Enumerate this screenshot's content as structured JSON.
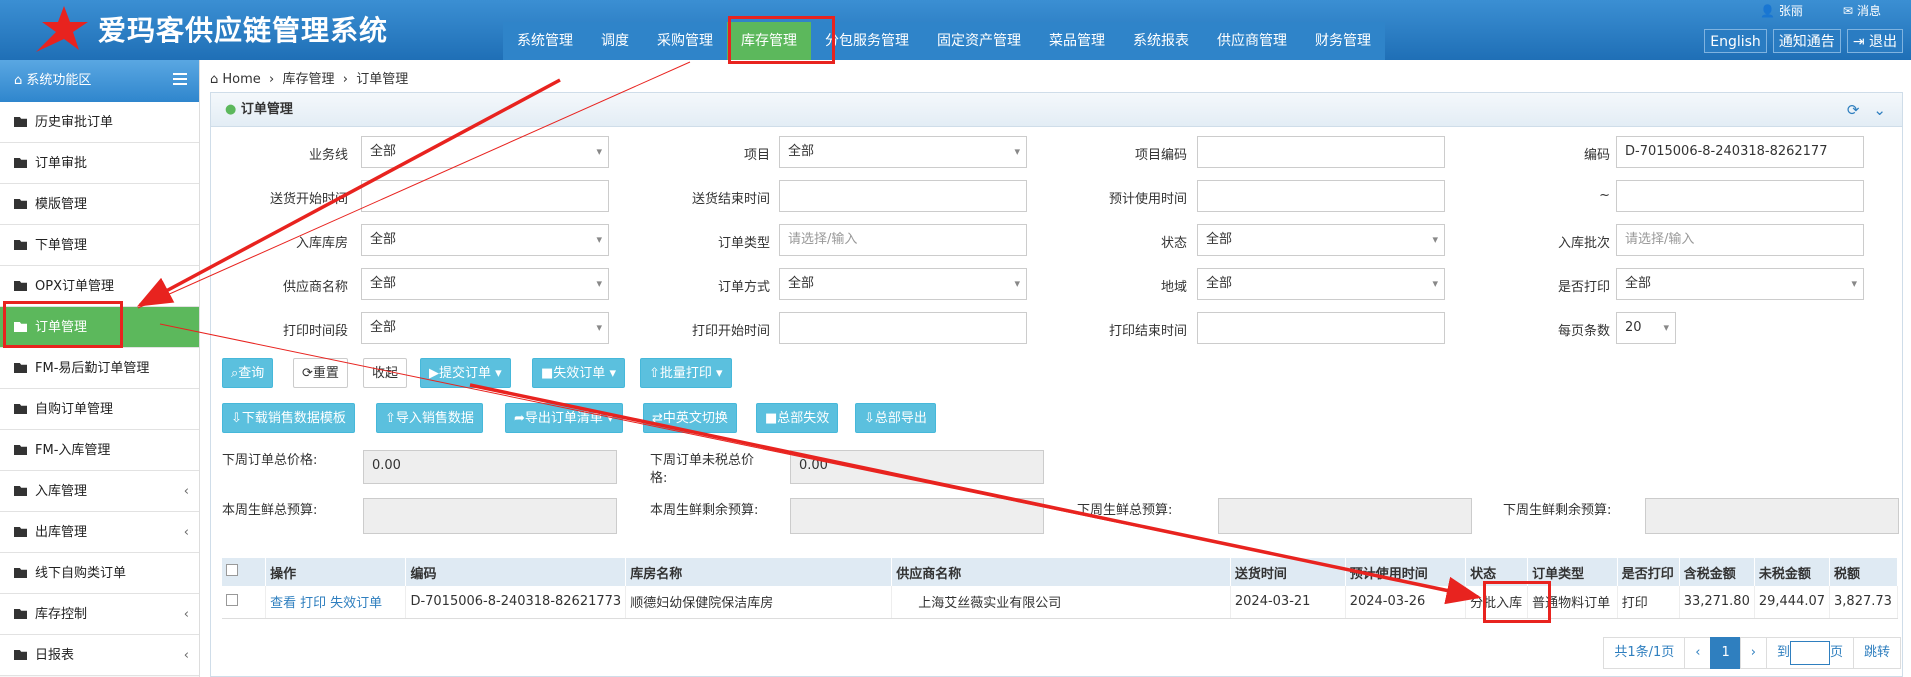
{
  "app": {
    "title": "爱玛客供应链管理系统"
  },
  "topnav": [
    "系统管理",
    "调度",
    "采购管理",
    "库存管理",
    "分包服务管理",
    "固定资产管理",
    "菜品管理",
    "系统报表",
    "供应商管理",
    "财务管理"
  ],
  "user": {
    "name": "张丽",
    "messages": "消息"
  },
  "header_buttons": [
    "English",
    "通知通告",
    "退出"
  ],
  "sidebar": {
    "title": "系统功能区",
    "items": [
      {
        "label": "历史审批订单",
        "chev": ""
      },
      {
        "label": "订单审批",
        "chev": ""
      },
      {
        "label": "模版管理",
        "chev": ""
      },
      {
        "label": "下单管理",
        "chev": ""
      },
      {
        "label": "OPX订单管理",
        "chev": ""
      },
      {
        "label": "订单管理",
        "chev": ""
      },
      {
        "label": "FM-易后勤订单管理",
        "chev": ""
      },
      {
        "label": "自购订单管理",
        "chev": ""
      },
      {
        "label": "FM-入库管理",
        "chev": ""
      },
      {
        "label": "入库管理",
        "chev": "‹"
      },
      {
        "label": "出库管理",
        "chev": "‹"
      },
      {
        "label": "线下自购类订单",
        "chev": ""
      },
      {
        "label": "库存控制",
        "chev": "‹"
      },
      {
        "label": "日报表",
        "chev": "‹"
      }
    ]
  },
  "breadcrumb": {
    "home": "Home",
    "sep": "›",
    "level1": "库存管理",
    "level2": "订单管理"
  },
  "panel": {
    "title": "订单管理"
  },
  "form": {
    "business_line": {
      "label": "业务线",
      "value": "全部"
    },
    "project": {
      "label": "项目",
      "value": "全部"
    },
    "project_code": {
      "label": "项目编码",
      "value": ""
    },
    "code": {
      "label": "编码",
      "value": "D-7015006-8-240318-8262177"
    },
    "delivery_start": {
      "label": "送货开始时间",
      "value": ""
    },
    "delivery_end": {
      "label": "送货结束时间",
      "value": ""
    },
    "expected_use": {
      "label": "预计使用时间",
      "value": ""
    },
    "tilde": {
      "label": "~",
      "value": ""
    },
    "warehouse": {
      "label": "入库库房",
      "value": "全部"
    },
    "order_type": {
      "label": "订单类型",
      "placeholder": "请选择/输入"
    },
    "status": {
      "label": "状态",
      "value": "全部"
    },
    "batch": {
      "label": "入库批次",
      "placeholder": "请选择/输入"
    },
    "supplier": {
      "label": "供应商名称",
      "value": "全部"
    },
    "order_mode": {
      "label": "订单方式",
      "value": "全部"
    },
    "region": {
      "label": "地域",
      "value": "全部"
    },
    "printed": {
      "label": "是否打印",
      "value": "全部"
    },
    "print_period": {
      "label": "打印时间段",
      "value": "全部"
    },
    "print_start": {
      "label": "打印开始时间",
      "value": ""
    },
    "print_end": {
      "label": "打印结束时间",
      "value": ""
    },
    "page_size": {
      "label": "每页条数",
      "value": "20"
    }
  },
  "buttons_row1": [
    "查询",
    "重置",
    "收起",
    "提交订单",
    "失效订单",
    "批量打印"
  ],
  "buttons_row2": [
    "下载销售数据模板",
    "导入销售数据",
    "导出订单清单",
    "中英文切换",
    "总部失效",
    "总部导出"
  ],
  "summary": {
    "next_week_total": {
      "label": "下周订单总价格:",
      "value": "0.00"
    },
    "next_week_untaxed": {
      "label": "下周订单未税总价格:",
      "value": "0.00"
    },
    "this_week_budget": {
      "label": "本周生鲜总预算:"
    },
    "this_week_remaining": {
      "label": "本周生鲜剩余预算:"
    },
    "next_week_budget": {
      "label": "下周生鲜总预算:"
    },
    "next_week_remaining": {
      "label": "下周生鲜剩余预算:"
    }
  },
  "table": {
    "columns": [
      "操作",
      "编码",
      "库房名称",
      "供应商名称",
      "送货时间",
      "预计使用时间",
      "状态",
      "订单类型",
      "是否打印",
      "含税金额",
      "未税金额",
      "税额"
    ],
    "rows": [
      {
        "actions": [
          "查看",
          "打印",
          "失效订单"
        ],
        "code": "D-7015006-8-240318-82621773",
        "warehouse": "顺德妇幼保健院保洁库房",
        "supplier": "上海艾丝薇实业有限公司",
        "delivery": "2024-03-21",
        "expected": "2024-03-26",
        "status": "分批入库",
        "type": "普通物料订单",
        "printed": "打印",
        "taxed": "33,271.80",
        "untaxed": "29,444.07",
        "tax": "3,827.73"
      }
    ]
  },
  "pager": {
    "summary": "共1条/1页",
    "prev": "‹",
    "current": "1",
    "next": "›",
    "goto_prefix": "到",
    "goto_suffix": "页",
    "jump": "跳转"
  },
  "colors": {
    "header": "#1f6fb6",
    "active": "#5cb85c",
    "button": "#5bc0de",
    "highlight": "#e8231f"
  }
}
